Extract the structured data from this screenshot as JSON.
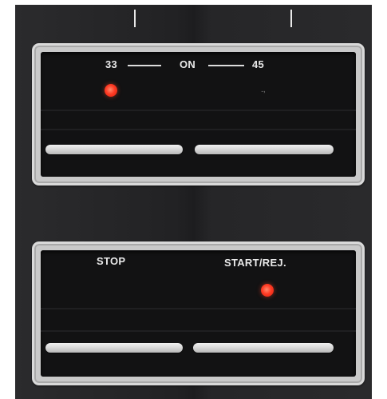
{
  "speed_selector": {
    "label_left": "33",
    "label_center": "ON",
    "label_right": "45"
  },
  "transport_controls": {
    "stop_label": "STOP",
    "start_reject_label": "START/REJ."
  },
  "colors": {
    "panel": "#121213",
    "bezel": "#d9d9d9",
    "led_on": "#ff3b24",
    "label_text": "#e9e9e9"
  }
}
